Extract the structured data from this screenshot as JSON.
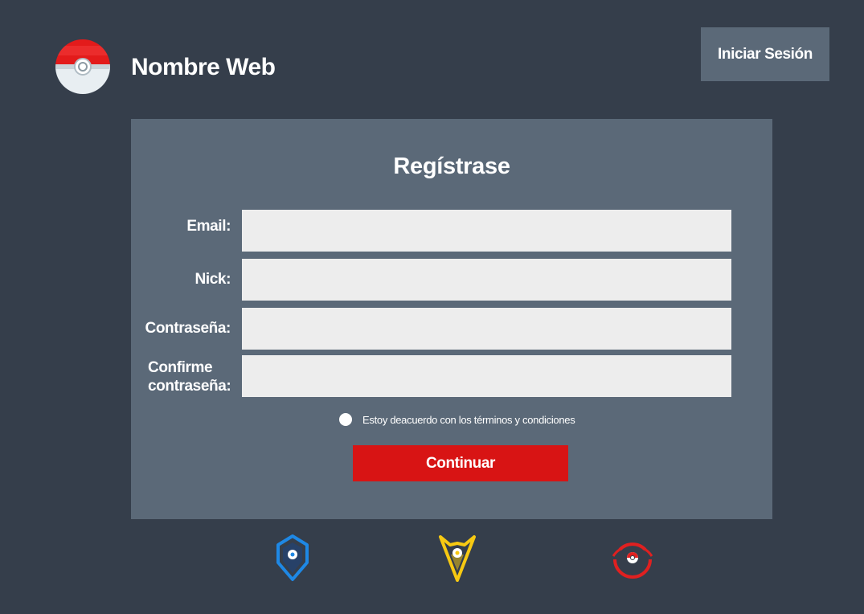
{
  "header": {
    "site_name": "Nombre Web",
    "login_label": "Iniciar Sesión",
    "logo_icon": "pokeball-icon"
  },
  "form": {
    "title": "Regístrase",
    "fields": [
      {
        "label": "Email:",
        "value": "",
        "placeholder": ""
      },
      {
        "label": "Nick:",
        "value": "",
        "placeholder": ""
      },
      {
        "label": "Contraseña:",
        "value": "",
        "placeholder": ""
      },
      {
        "label": "Confirme contraseña:",
        "value": "",
        "placeholder": ""
      }
    ],
    "terms_label": "Estoy deacuerdo con los términos y condiciones",
    "terms_checked": false,
    "submit_label": "Continuar"
  },
  "teams": [
    {
      "icon": "team-mystic-icon",
      "color": "#1e88e5"
    },
    {
      "icon": "team-instinct-icon",
      "color": "#f7c912"
    },
    {
      "icon": "team-valor-icon",
      "color": "#e02020"
    }
  ],
  "colors": {
    "background": "#353e4b",
    "panel": "#5b6978",
    "accent": "#d81414",
    "input": "#ededed"
  }
}
